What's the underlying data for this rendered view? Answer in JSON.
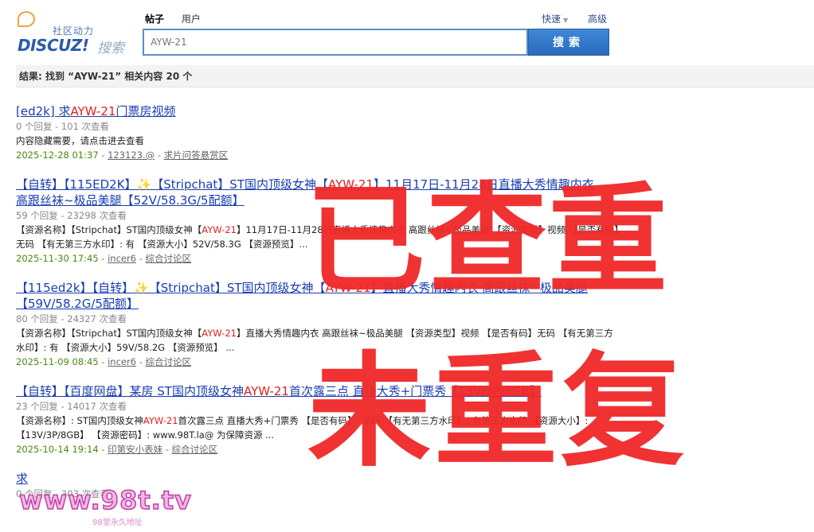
{
  "logo": {
    "tagline": "社区动力",
    "brand": "DISCUZ!",
    "search_word": "搜索"
  },
  "tabs": [
    {
      "label": "帖子",
      "active": true
    },
    {
      "label": "用户",
      "active": false
    }
  ],
  "search": {
    "value": "AYW-21",
    "button": "搜索"
  },
  "links": {
    "quick": "快速",
    "advanced": "高级"
  },
  "summary": "结果: 找到 “AYW-21” 相关内容 20 个",
  "results": [
    {
      "title_pre": "[ed2k] 求",
      "title_hl": "AYW-21",
      "title_post": "门票房视频",
      "title_line2": "",
      "meta": "0 个回复 - 101 次查看",
      "desc_pre": "内容隐藏需要，请点击进去查看",
      "desc_hl": "",
      "desc_post": "",
      "date": "2025-12-28 01:37",
      "author": "123123.@",
      "forum": "求片问答悬赏区"
    },
    {
      "title_pre": "【自转】【115ED2K】✨【Stripchat】ST国内顶级女神【",
      "title_hl": "AYW-21",
      "title_post": "】11月17日-11月28日直播大秀情趣内衣",
      "title_line2": "高跟丝袜~极品美腿【52V/58.3G/5配额】",
      "meta": "59 个回复 - 23298 次查看",
      "desc_pre": "【资源名称】【Stripchat】ST国内顶级女神【",
      "desc_hl": "AYW-21",
      "desc_post": "】11月17日-11月28日直播大秀情趣内衣 高跟丝袜~极品美腿 【资源类型】视频 【是否有码】无码 【有无第三方水印】: 有 【资源大小】52V/58.3G 【资源预览】...",
      "date": "2025-11-30 17:45",
      "author": "incer6",
      "forum": "综合讨论区"
    },
    {
      "title_pre": "【115ed2k】【自转】✨【Stripchat】ST国内顶级女神【",
      "title_hl": "AYW-21",
      "title_post": "】直播大秀情趣内衣 高跟丝袜~极品美腿",
      "title_line2": "【59V/58.2G/5配额】",
      "meta": "80 个回复 - 24327 次查看",
      "desc_pre": "【资源名称】【Stripchat】ST国内顶级女神【",
      "desc_hl": "AYW-21",
      "desc_post": "】直播大秀情趣内衣 高跟丝袜~极品美腿 【资源类型】视频 【是否有码】无码 【有无第三方水印】: 有 【资源大小】59V/58.2G 【资源预览】 ...",
      "date": "2025-11-09 08:45",
      "author": "incer6",
      "forum": "综合讨论区"
    },
    {
      "title_pre": "【自转】【百度网盘】某房 ST国内顶级女神",
      "title_hl": "AYW-21",
      "title_post": "首次露三点 直播大秀+门票秀【13V/3P/8GB】",
      "title_line2": "",
      "meta": "23 个回复 - 14017 次查看",
      "desc_pre": "【资源名称】: ST国内顶级女神",
      "desc_hl": "AYW-21",
      "desc_post": "首次露三点 直播大秀+门票秀 【是否有码】: 无码 【有无第三方水印】: 有第三方水印 【资源大小】: 【13V/3P/8GB】 【资源密码】: www.98T.la@ 为保障资源 ...",
      "date": "2025-10-14 19:14",
      "author": "印第安小表妹",
      "forum": "综合讨论区"
    },
    {
      "title_pre": "求",
      "title_hl": "",
      "title_post": "",
      "title_line2": "",
      "meta": "0 个回复 - 303 次查看",
      "desc_pre": "",
      "desc_hl": "",
      "desc_post": "",
      "date": "",
      "author": "",
      "forum": ""
    }
  ],
  "stamps": {
    "top": "已查重",
    "bottom": "未重复"
  },
  "watermark": {
    "text": "www.98t.tv",
    "sub": "98堂永久地址"
  },
  "colors": {
    "highlight": "#e02020",
    "link": "#1a3eb0",
    "stamp": "#f02828",
    "search_button": "#2a6bbd",
    "date": "#4a8a10"
  }
}
